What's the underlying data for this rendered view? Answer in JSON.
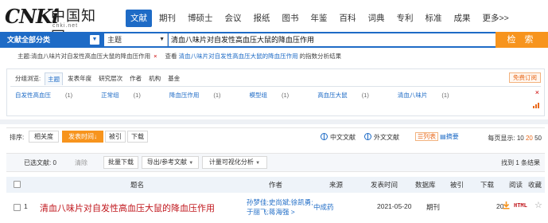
{
  "logo": {
    "brand": "CNKi",
    "cn_name": "中国知网",
    "url": "cnki.net"
  },
  "nav": {
    "items": [
      "文献",
      "期刊",
      "博硕士",
      "会议",
      "报纸",
      "图书",
      "年鉴",
      "百科",
      "词典",
      "专利",
      "标准",
      "成果"
    ],
    "more": "更多>>",
    "active_index": 0
  },
  "search": {
    "scope": "文献全部分类",
    "field": "主题",
    "query": "清血八味片对自发性高血压大鼠的降血压作用",
    "button": "检 索"
  },
  "subject_row": {
    "subject_text": "主题:清血八味片对自发性高血压大鼠的降血压作用",
    "close": "×",
    "view_prefix": "查看",
    "view_link": "清血八味片对自发性高血压大鼠的降血压作用",
    "view_suffix": "的指数分析结果"
  },
  "grouping": {
    "label": "分组浏览:",
    "tabs": [
      "主题",
      "发表年度",
      "研究层次",
      "作者",
      "机构",
      "基金"
    ],
    "active_tab": 0,
    "subscribe": "免费订阅",
    "items": [
      {
        "name": "自发性高血压",
        "count": "(1)"
      },
      {
        "name": "正常组",
        "count": "(1)"
      },
      {
        "name": "降血压作用",
        "count": "(1)"
      },
      {
        "name": "模型组",
        "count": "(1)"
      },
      {
        "name": "高血压大鼠",
        "count": "(1)"
      },
      {
        "name": "清血八味片",
        "count": "(1)"
      }
    ],
    "close": "×"
  },
  "sort": {
    "label": "排序:",
    "options": [
      "相关度",
      "发表时间↓",
      "被引",
      "下载"
    ],
    "active_index": 1,
    "lang_cn": "中文文献",
    "lang_en": "外文文献",
    "view_list": "列表",
    "view_abstract": "摘要",
    "per_page_label": "每页显示:",
    "per_page": [
      "10",
      "20",
      "50"
    ],
    "per_page_active": 1
  },
  "selection": {
    "selected_label": "已选文献: 0",
    "clear": "清除",
    "buttons": [
      "批量下载",
      "导出/参考文献",
      "计量可视化分析"
    ],
    "found": "找到 1 条结果"
  },
  "table": {
    "headers": [
      "题名",
      "作者",
      "来源",
      "发表时间",
      "数据库",
      "被引",
      "下载",
      "阅读",
      "收藏"
    ],
    "rows": [
      {
        "num": "1",
        "title": "清血八味片对自发性高血压大鼠的降血压作用",
        "authors_line1": "孙梦佳;史尚斌;徐凯勇;",
        "authors_line2": "于丽飞;蒋海强 >",
        "source": "中成药",
        "date": "2021-05-20",
        "db": "期刊",
        "cited": "",
        "downloads": "20",
        "read": "HTML"
      }
    ]
  },
  "colors": {
    "primary": "#1e6bc6",
    "accent": "#f7941d",
    "title_red": "#c0161c"
  }
}
